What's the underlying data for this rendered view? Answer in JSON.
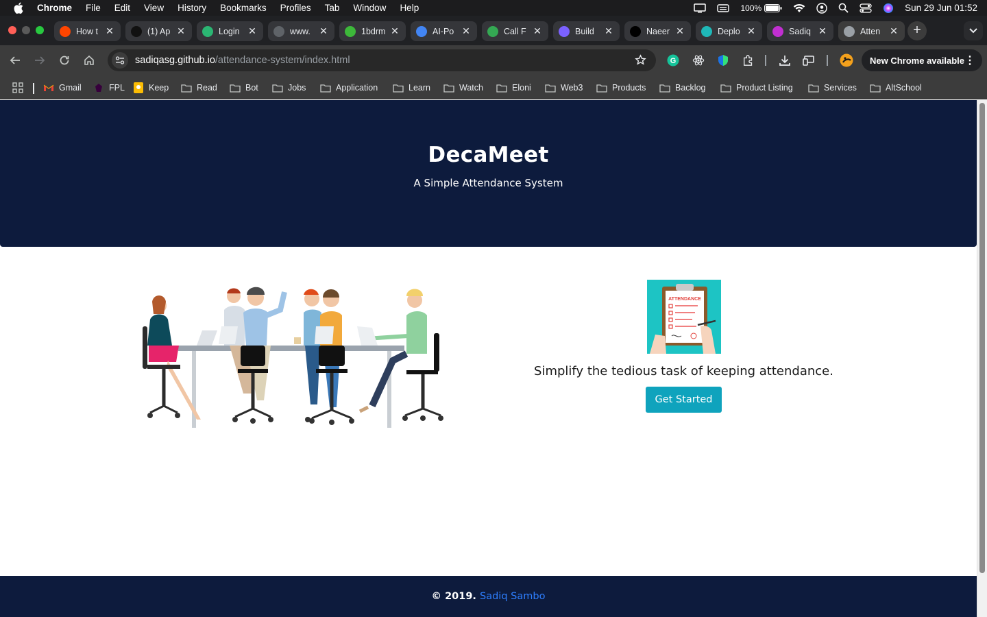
{
  "menubar": {
    "app": "Chrome",
    "items": [
      "File",
      "Edit",
      "View",
      "History",
      "Bookmarks",
      "Profiles",
      "Tab",
      "Window",
      "Help"
    ],
    "battery": "100%",
    "datetime": "Sun 29 Jun  01:52"
  },
  "tabs": [
    {
      "title": "How t",
      "icon": "reddit-icon",
      "color": "#ff4500"
    },
    {
      "title": "(1) Ap",
      "icon": "medium-icon",
      "color": "#111111"
    },
    {
      "title": "Login",
      "icon": "letter-f-icon",
      "color": "#2bb673"
    },
    {
      "title": "www.",
      "icon": "loading-icon",
      "color": "#5f6368"
    },
    {
      "title": "1bdrm",
      "icon": "jiji-icon",
      "color": "#3db83a"
    },
    {
      "title": "AI-Po",
      "icon": "chart-icon",
      "color": "#4285f4"
    },
    {
      "title": "Call F",
      "icon": "globe-icon",
      "color": "#34a853"
    },
    {
      "title": "Build",
      "icon": "ethereum-icon",
      "color": "#7b61ff"
    },
    {
      "title": "Naeer",
      "icon": "x-icon",
      "color": "#000000"
    },
    {
      "title": "Deplo",
      "icon": "diamond-icon",
      "color": "#1fb8b8"
    },
    {
      "title": "Sadiq",
      "icon": "ss-icon",
      "color": "#c12fd1"
    },
    {
      "title": "Atten",
      "icon": "globe-icon",
      "color": "#9aa0a6",
      "active": true
    }
  ],
  "toolbar": {
    "url_host": "sadiqasg.github.io",
    "url_path": "/attendance-system/index.html",
    "new_chrome": "New Chrome available"
  },
  "bookmarks": [
    {
      "label": "Gmail",
      "icon": "gmail-icon"
    },
    {
      "label": "FPL",
      "icon": "fpl-icon"
    },
    {
      "label": "Keep",
      "icon": "keep-icon"
    },
    {
      "label": "Read",
      "icon": "folder-icon"
    },
    {
      "label": "Bot",
      "icon": "folder-icon"
    },
    {
      "label": "Jobs",
      "icon": "folder-icon"
    },
    {
      "label": "Application",
      "icon": "folder-icon"
    },
    {
      "label": "Learn",
      "icon": "folder-icon"
    },
    {
      "label": "Watch",
      "icon": "folder-icon"
    },
    {
      "label": "Eloni",
      "icon": "folder-icon"
    },
    {
      "label": "Web3",
      "icon": "folder-icon"
    },
    {
      "label": "Products",
      "icon": "folder-icon"
    },
    {
      "label": "Backlog",
      "icon": "folder-icon"
    },
    {
      "label": "Product Listing",
      "icon": "folder-icon"
    },
    {
      "label": "Services",
      "icon": "folder-icon"
    },
    {
      "label": "AltSchool",
      "icon": "folder-icon"
    }
  ],
  "page": {
    "title": "DecaMeet",
    "subtitle": "A Simple Attendance System",
    "clipboard_label": "ATTENDANCE",
    "tagline": "Simplify the tedious task of keeping attendance.",
    "cta": "Get Started",
    "footer_prefix": "© 2019.",
    "footer_author": "Sadiq Sambo",
    "colors": {
      "navy": "#0d1b3d",
      "teal": "#0fa3bd",
      "link": "#2e7fff"
    }
  }
}
